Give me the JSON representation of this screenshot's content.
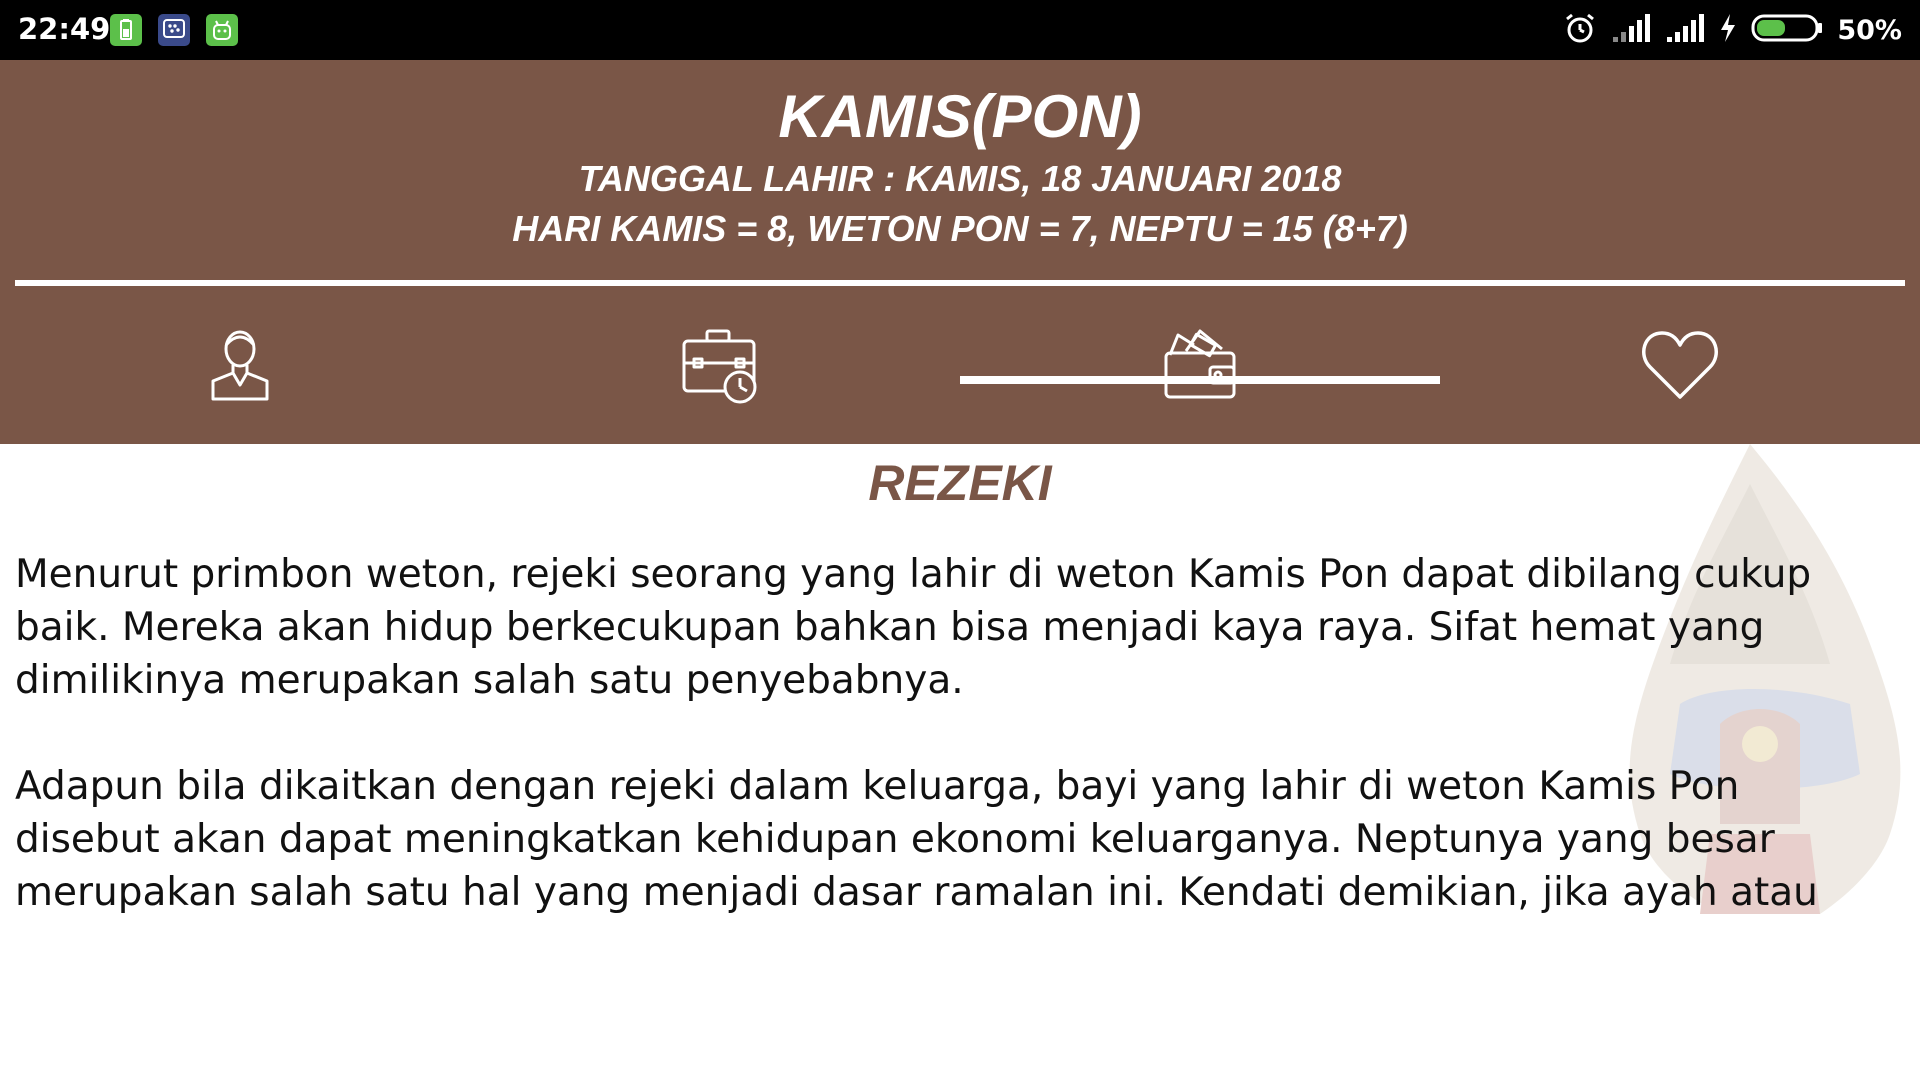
{
  "status_bar": {
    "time": "22:49",
    "battery_percent": "50%",
    "battery_level": 0.5,
    "notification_icons": [
      "battery-app-icon",
      "bbm-icon",
      "android-icon"
    ],
    "system_icons": [
      "alarm-icon",
      "signal-icon",
      "signal-icon",
      "charging-icon",
      "battery-icon"
    ]
  },
  "header": {
    "title": "KAMIS(PON)",
    "birth_date": "TANGGAL LAHIR : KAMIS, 18 JANUARI 2018",
    "neptu": "HARI KAMIS = 8, WETON PON = 7, NEPTU = 15 (8+7)"
  },
  "tabs": [
    {
      "icon": "person-icon",
      "selected": false
    },
    {
      "icon": "briefcase-clock-icon",
      "selected": false
    },
    {
      "icon": "wallet-icon",
      "selected": true
    },
    {
      "icon": "heart-icon",
      "selected": false
    }
  ],
  "content": {
    "section_title": "REZEKI",
    "paragraphs": [
      "Menurut primbon weton, rejeki seorang yang lahir di weton Kamis Pon dapat dibilang cukup baik. Mereka akan hidup berkecukupan bahkan bisa menjadi kaya raya. Sifat hemat yang dimilikinya merupakan salah satu penyebabnya.",
      "Adapun bila dikaitkan dengan rejeki dalam keluarga, bayi yang lahir di weton Kamis Pon disebut akan dapat meningkatkan kehidupan ekonomi keluarganya. Neptunya yang besar merupakan salah satu hal yang menjadi dasar ramalan ini. Kendati demikian, jika ayah atau"
    ],
    "background_image": "wayang-gunungan"
  },
  "colors": {
    "header_bg": "#7a5647",
    "accent_text": "#7a5647",
    "status_bar_bg": "#000000"
  }
}
